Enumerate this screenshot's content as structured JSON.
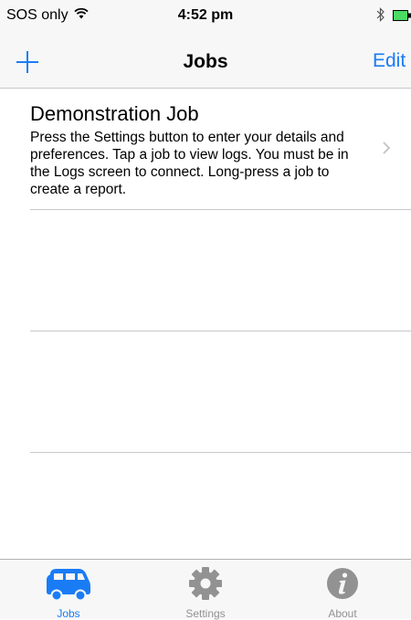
{
  "status": {
    "carrier": "SOS only",
    "time": "4:52 pm"
  },
  "nav": {
    "title": "Jobs",
    "edit_label": "Edit"
  },
  "jobs": [
    {
      "title": "Demonstration Job",
      "description": "Press the Settings button to enter your details and preferences. Tap a job to view logs. You must be in the Logs screen to connect. Long-press a job to create a report."
    }
  ],
  "tabs": [
    {
      "label": "Jobs",
      "icon": "van-icon",
      "active": true
    },
    {
      "label": "Settings",
      "icon": "gear-icon",
      "active": false
    },
    {
      "label": "About",
      "icon": "info-icon",
      "active": false
    }
  ],
  "colors": {
    "accent": "#1a7cf5",
    "inactive_tab": "#929292",
    "battery": "#4cd964"
  }
}
